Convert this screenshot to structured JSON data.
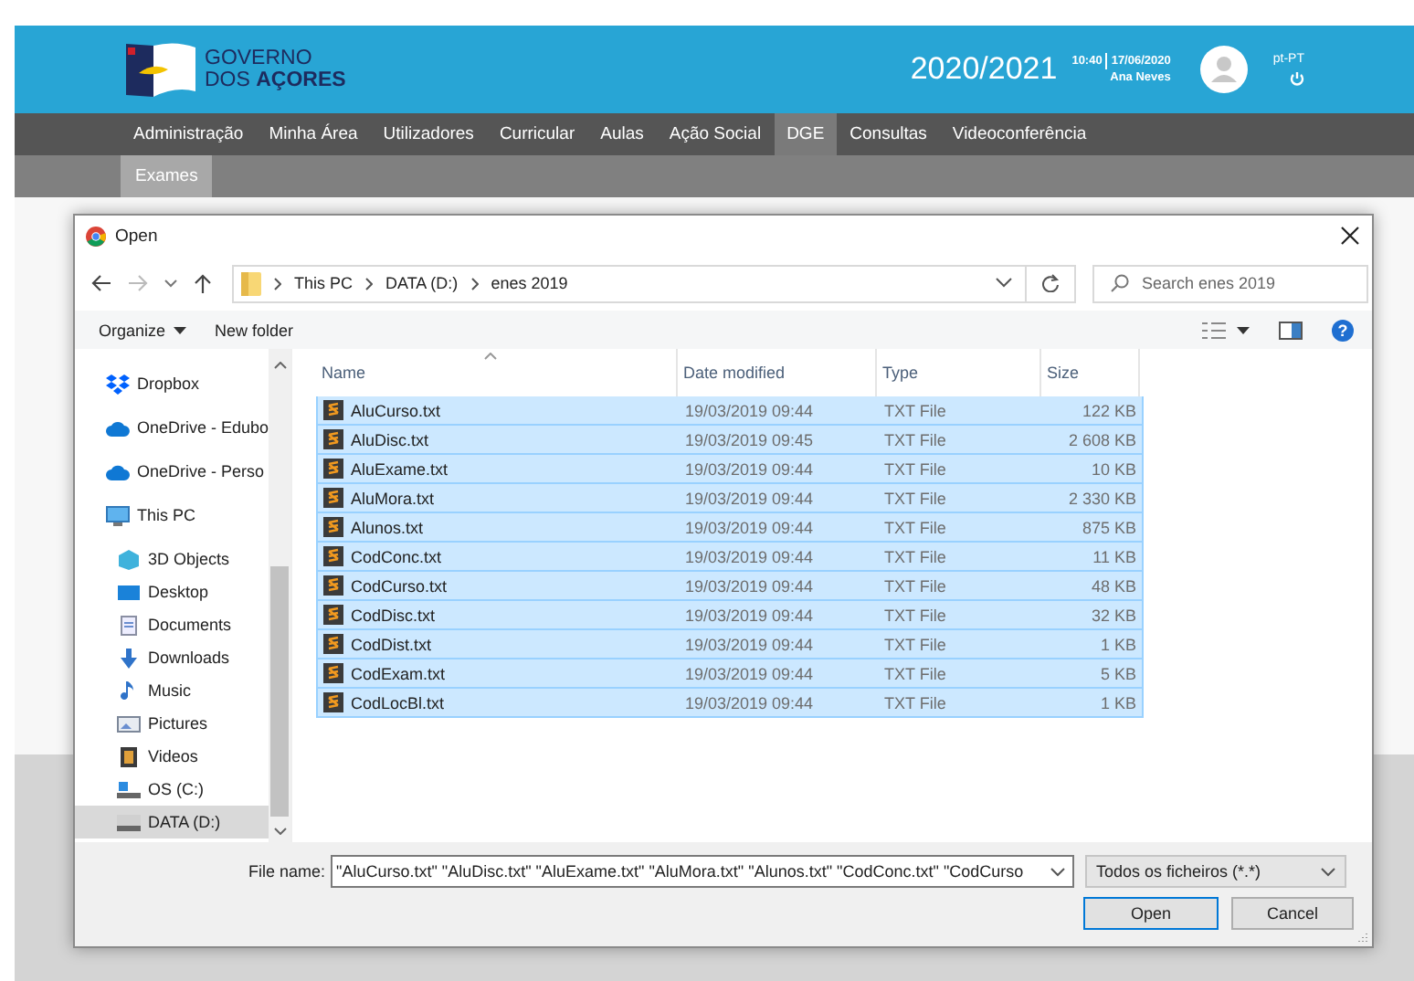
{
  "header": {
    "logo_lines": [
      "GOVERNO",
      "DOS **AÇORES**"
    ],
    "year": "2020/2021",
    "time": "10:40",
    "date": "17/06/2020",
    "user": "Ana Neves",
    "language": "pt-PT"
  },
  "menu": [
    {
      "label": "Administração",
      "selected": false
    },
    {
      "label": "Minha Área",
      "selected": false
    },
    {
      "label": "Utilizadores",
      "selected": false
    },
    {
      "label": "Curricular",
      "selected": false
    },
    {
      "label": "Aulas",
      "selected": false
    },
    {
      "label": "Ação Social",
      "selected": false
    },
    {
      "label": "DGE",
      "selected": true
    },
    {
      "label": "Consultas",
      "selected": false
    },
    {
      "label": "Videoconferência",
      "selected": false
    }
  ],
  "submenu": [
    {
      "label": "Exames",
      "selected": true
    }
  ],
  "dialog": {
    "title": "Open",
    "breadcrumb": [
      "This PC",
      "DATA (D:)",
      "enes 2019"
    ],
    "search": {
      "placeholder": "Search enes 2019"
    },
    "toolbar": {
      "organize": "Organize",
      "new_folder": "New folder",
      "help": "?"
    },
    "nav_items": [
      {
        "label": "Dropbox",
        "kind": "dropbox",
        "selected": false
      },
      {
        "label": "OneDrive - Edubo",
        "kind": "cloud",
        "selected": false
      },
      {
        "label": "OneDrive - Perso",
        "kind": "cloud",
        "selected": false
      },
      {
        "label": "This PC",
        "kind": "pc",
        "selected": false,
        "children": [
          {
            "label": "3D Objects",
            "kind": "cube",
            "selected": false
          },
          {
            "label": "Desktop",
            "kind": "desktop",
            "selected": false
          },
          {
            "label": "Documents",
            "kind": "documents",
            "selected": false
          },
          {
            "label": "Downloads",
            "kind": "downloads",
            "selected": false
          },
          {
            "label": "Music",
            "kind": "music",
            "selected": false
          },
          {
            "label": "Pictures",
            "kind": "pictures",
            "selected": false
          },
          {
            "label": "Videos",
            "kind": "videos",
            "selected": false
          },
          {
            "label": "OS (C:)",
            "kind": "osdrive",
            "selected": false
          },
          {
            "label": "DATA (D:)",
            "kind": "drive",
            "selected": true
          }
        ]
      }
    ],
    "columns": [
      "Name",
      "Date modified",
      "Type",
      "Size"
    ],
    "files": [
      {
        "name": "AluCurso.txt",
        "date": "19/03/2019 09:44",
        "type": "TXT File",
        "size": "122 KB",
        "selected": true
      },
      {
        "name": "AluDisc.txt",
        "date": "19/03/2019 09:45",
        "type": "TXT File",
        "size": "2 608 KB",
        "selected": true
      },
      {
        "name": "AluExame.txt",
        "date": "19/03/2019 09:44",
        "type": "TXT File",
        "size": "10 KB",
        "selected": true
      },
      {
        "name": "AluMora.txt",
        "date": "19/03/2019 09:44",
        "type": "TXT File",
        "size": "2 330 KB",
        "selected": true
      },
      {
        "name": "Alunos.txt",
        "date": "19/03/2019 09:44",
        "type": "TXT File",
        "size": "875 KB",
        "selected": true
      },
      {
        "name": "CodConc.txt",
        "date": "19/03/2019 09:44",
        "type": "TXT File",
        "size": "11 KB",
        "selected": true
      },
      {
        "name": "CodCurso.txt",
        "date": "19/03/2019 09:44",
        "type": "TXT File",
        "size": "48 KB",
        "selected": true
      },
      {
        "name": "CodDisc.txt",
        "date": "19/03/2019 09:44",
        "type": "TXT File",
        "size": "32 KB",
        "selected": true
      },
      {
        "name": "CodDist.txt",
        "date": "19/03/2019 09:44",
        "type": "TXT File",
        "size": "1 KB",
        "selected": true
      },
      {
        "name": "CodExam.txt",
        "date": "19/03/2019 09:44",
        "type": "TXT File",
        "size": "5 KB",
        "selected": true
      },
      {
        "name": "CodLocBl.txt",
        "date": "19/03/2019 09:44",
        "type": "TXT File",
        "size": "1 KB",
        "selected": true
      }
    ],
    "file_name_label": "File name:",
    "file_name_value": "\"AluCurso.txt\" \"AluDisc.txt\" \"AluExame.txt\" \"AluMora.txt\" \"Alunos.txt\" \"CodConc.txt\" \"CodCurso",
    "file_type": "Todos os ficheiros (*.*)",
    "buttons": [
      "Open",
      "Cancel"
    ]
  }
}
